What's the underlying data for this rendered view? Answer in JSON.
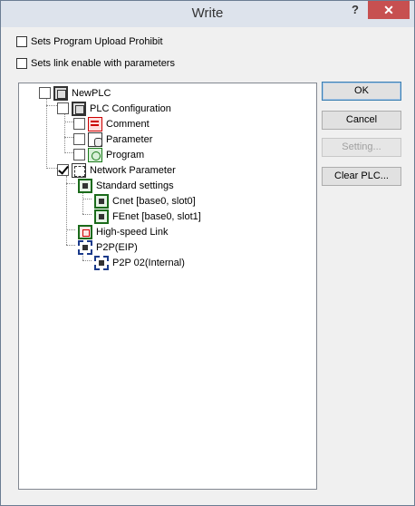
{
  "window": {
    "title": "Write",
    "help_label": "?",
    "close_label": "✕"
  },
  "options": {
    "upload_prohibit": {
      "label": "Sets Program Upload Prohibit",
      "checked": false
    },
    "link_enable": {
      "label": "Sets link enable with parameters",
      "checked": false
    }
  },
  "tree": {
    "root": {
      "label": "NewPLC",
      "icon": "plc-icon",
      "checked": false
    },
    "plc_config": {
      "label": "PLC Configuration",
      "icon": "plc-icon",
      "checked": false
    },
    "comment": {
      "label": "Comment",
      "icon": "comment-icon",
      "checked": false
    },
    "parameter": {
      "label": "Parameter",
      "icon": "parameter-icon",
      "checked": false
    },
    "program": {
      "label": "Program",
      "icon": "program-icon",
      "checked": false
    },
    "network_param": {
      "label": "Network Parameter",
      "icon": "network-icon",
      "checked": true
    },
    "standard_settings": {
      "label": "Standard settings",
      "icon": "module-icon"
    },
    "cnet": {
      "label": "Cnet [base0, slot0]",
      "icon": "module-icon"
    },
    "fenet": {
      "label": "FEnet [base0, slot1]",
      "icon": "module-icon"
    },
    "high_speed": {
      "label": "High-speed Link",
      "icon": "highspeed-icon"
    },
    "p2p_eip": {
      "label": "P2P(EIP)",
      "icon": "p2p-icon"
    },
    "p2p02": {
      "label": "P2P 02(Internal)",
      "icon": "p2p-icon"
    }
  },
  "buttons": {
    "ok": "OK",
    "cancel": "Cancel",
    "setting": "Setting...",
    "clear_plc": "Clear PLC..."
  },
  "colors": {
    "close": "#c75050",
    "title_bg": "#dde3ec",
    "default_border": "#3c7fb1"
  }
}
